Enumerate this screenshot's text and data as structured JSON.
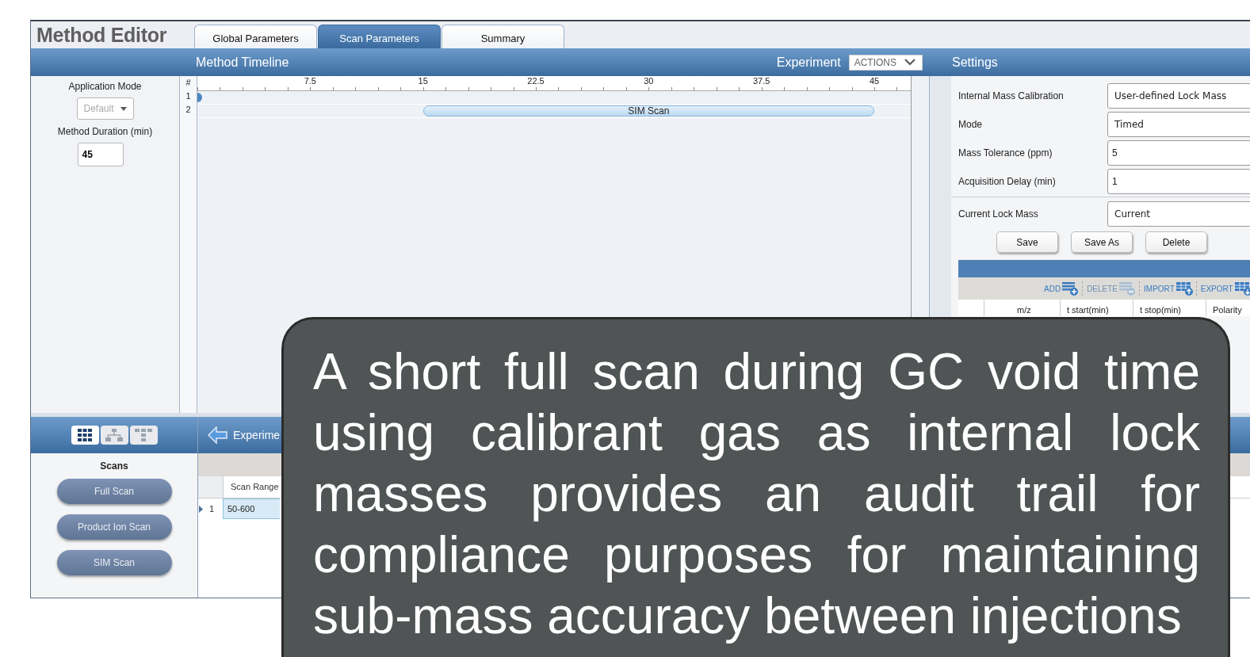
{
  "window": {
    "title": "Method Editor"
  },
  "tabs": [
    {
      "label": "Global Parameters",
      "selected": false
    },
    {
      "label": "Scan Parameters",
      "selected": true
    },
    {
      "label": "Summary",
      "selected": false
    }
  ],
  "method_panel": {
    "application_mode_label": "Application Mode",
    "application_mode": {
      "value": "Default",
      "disabled": true
    },
    "duration_label": "Method Duration (min)",
    "duration": "45"
  },
  "timeline": {
    "title": "Method Timeline",
    "experiment_label": "Experiment",
    "actions_dropdown": "ACTIONS",
    "row_header": "#",
    "ticks": [
      "7.5",
      "15",
      "22.5",
      "30",
      "37.5",
      "45"
    ],
    "rows": [
      {
        "number": "1",
        "kind": "marker"
      },
      {
        "number": "2",
        "kind": "bar",
        "label": "SIM Scan"
      }
    ]
  },
  "settings": {
    "title": "Settings",
    "fields": [
      {
        "label": "Internal Mass Calibration",
        "kind": "dropdown",
        "value": "User-defined Lock Mass"
      },
      {
        "label": "Mode",
        "kind": "dropdown",
        "value": "Timed"
      },
      {
        "label": "Mass Tolerance (ppm)",
        "kind": "input",
        "value": "5"
      },
      {
        "label": "Acquisition Delay (min)",
        "kind": "input",
        "value": "1"
      }
    ],
    "lock_mass": {
      "label": "Current Lock Mass",
      "value": "Current"
    },
    "buttons": [
      "Save",
      "Save As",
      "Delete"
    ],
    "toolbar": [
      {
        "label": "ADD",
        "kind": "add",
        "disabled": false
      },
      {
        "label": "DELETE",
        "kind": "delete",
        "disabled": true
      },
      {
        "label": "IMPORT",
        "kind": "import",
        "disabled": false
      },
      {
        "label": "EXPORT",
        "kind": "export",
        "disabled": false
      }
    ],
    "columns": [
      "m/z",
      "t start(min)",
      "t stop(min)",
      "Polarity"
    ]
  },
  "scans_panel": {
    "views": [
      {
        "kind": "grid",
        "selected": true
      },
      {
        "kind": "tree",
        "selected": false
      },
      {
        "kind": "layout",
        "selected": false
      }
    ],
    "title": "Scans",
    "buttons": [
      "Full Scan",
      "Product Ion Scan",
      "SIM Scan"
    ]
  },
  "experiment_panel": {
    "title": "Experime",
    "columns": [
      "Scan Range"
    ],
    "rows": [
      {
        "number": "1",
        "selected": true,
        "cells": [
          "50-600"
        ]
      }
    ]
  },
  "callout": {
    "text": "A short full scan during GC void time using calibrant gas as internal lock masses provides an audit trail for compliance purposes for maintaining sub-mass accuracy between injections"
  }
}
